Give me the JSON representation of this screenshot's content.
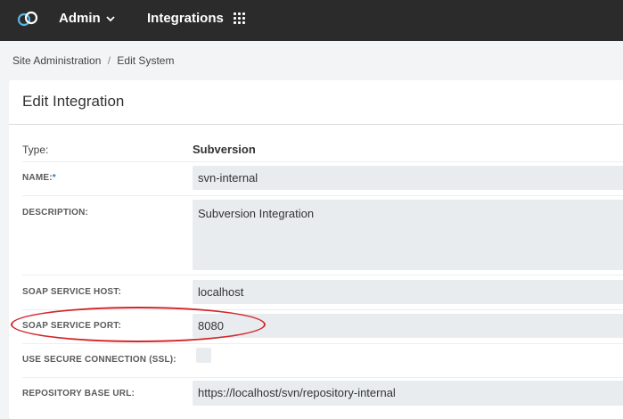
{
  "topbar": {
    "logo_icon": "link-rings-icon",
    "admin_label": "Admin",
    "integrations_label": "Integrations",
    "bg_color": "#2b2b2b"
  },
  "breadcrumb": {
    "root": "Site Administration",
    "separator": "/",
    "current": "Edit System"
  },
  "card": {
    "title": "Edit Integration"
  },
  "form": {
    "type_label": "Type:",
    "type_value": "Subversion",
    "name_label": "NAME:",
    "name_required_mark": "*",
    "name_value": "svn-internal",
    "description_label": "DESCRIPTION:",
    "description_value": "Subversion Integration",
    "soap_host_label": "SOAP SERVICE HOST:",
    "soap_host_value": "localhost",
    "soap_port_label": "SOAP SERVICE PORT:",
    "soap_port_value": "8080",
    "ssl_label": "USE SECURE CONNECTION (SSL):",
    "ssl_checked": false,
    "repo_url_label": "REPOSITORY BASE URL:",
    "repo_url_value": "https://localhost/svn/repository-internal"
  },
  "annotation": {
    "highlight_color": "#d3262b"
  }
}
